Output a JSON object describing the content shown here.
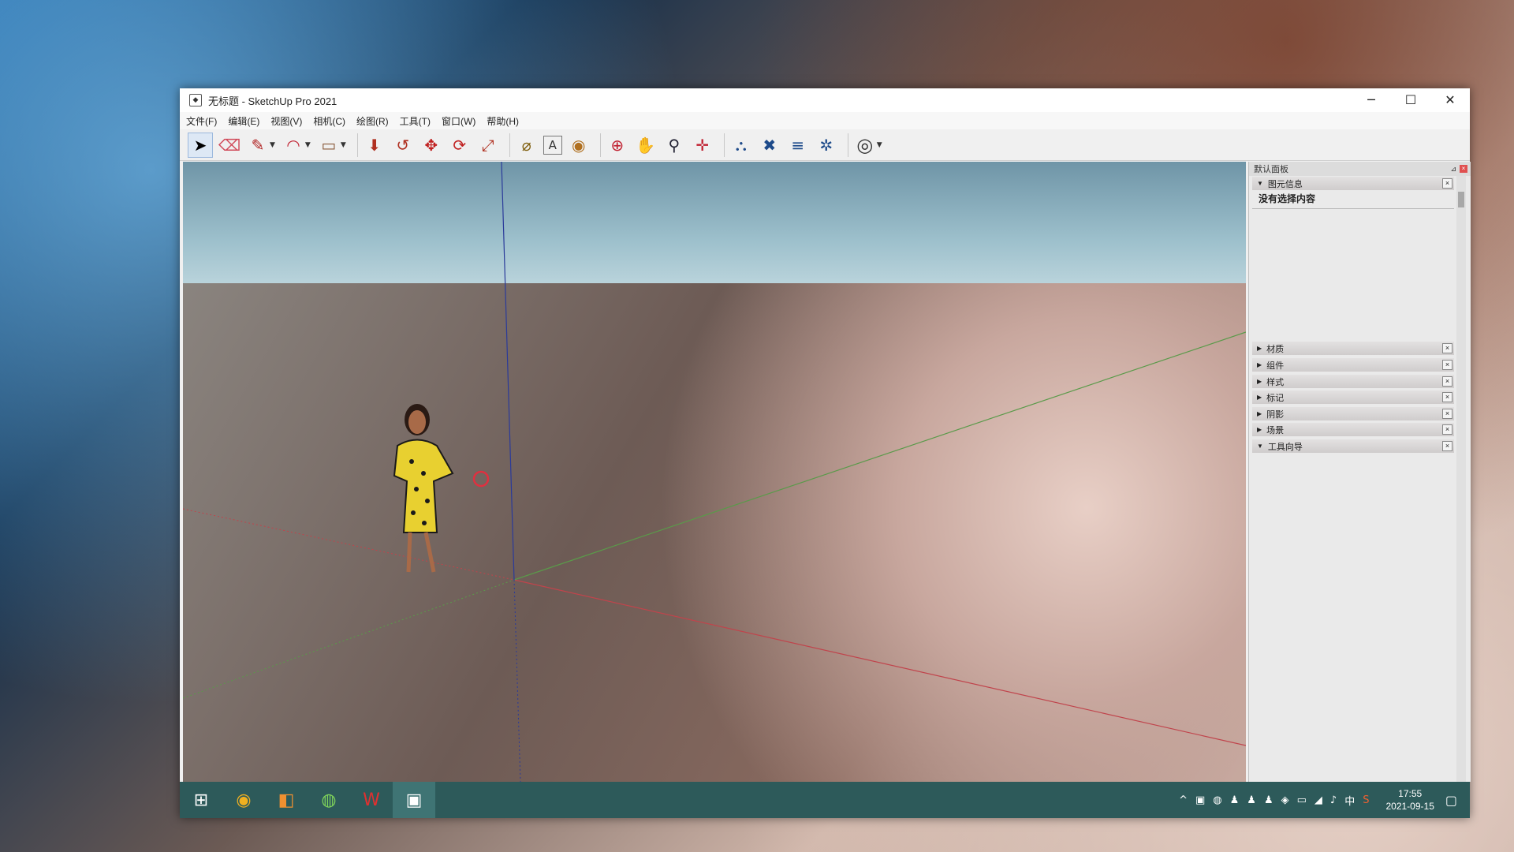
{
  "window": {
    "title": "无标题 - SketchUp Pro 2021",
    "app_icon": "sketchup-icon",
    "controls": {
      "minimize": "─",
      "maximize": "☐",
      "close": "✕"
    }
  },
  "menu": [
    "文件(F)",
    "编辑(E)",
    "视图(V)",
    "相机(C)",
    "绘图(R)",
    "工具(T)",
    "窗口(W)",
    "帮助(H)"
  ],
  "toolbar": {
    "tools": [
      {
        "name": "select-icon",
        "glyph": "➤"
      },
      {
        "name": "eraser-icon",
        "glyph": "⌫"
      },
      {
        "name": "line-icon",
        "glyph": "✎"
      },
      {
        "name": "arc-icon",
        "glyph": "◠"
      },
      {
        "name": "rectangle-icon",
        "glyph": "▭"
      },
      {
        "name": "push-pull-icon",
        "glyph": "⬇"
      },
      {
        "name": "offset-icon",
        "glyph": "↺"
      },
      {
        "name": "move-icon",
        "glyph": "✥"
      },
      {
        "name": "rotate-icon",
        "glyph": "⟳"
      },
      {
        "name": "scale-icon",
        "glyph": "⤢"
      },
      {
        "name": "tape-measure-icon",
        "glyph": "⌀"
      },
      {
        "name": "text-icon",
        "glyph": "A"
      },
      {
        "name": "paint-bucket-icon",
        "glyph": "◉"
      },
      {
        "name": "orbit-icon",
        "glyph": "⊕"
      },
      {
        "name": "pan-icon",
        "glyph": "✋"
      },
      {
        "name": "zoom-icon",
        "glyph": "⚲"
      },
      {
        "name": "zoom-extents-icon",
        "glyph": "✛"
      },
      {
        "name": "warehouse-icon",
        "glyph": "⛬"
      },
      {
        "name": "extension-warehouse-icon",
        "glyph": "✖"
      },
      {
        "name": "layout-icon",
        "glyph": "≡"
      },
      {
        "name": "extension-manager-icon",
        "glyph": "✲"
      },
      {
        "name": "account-icon",
        "glyph": "◎"
      }
    ]
  },
  "panel": {
    "title": "默认面板",
    "entity_info": {
      "label": "图元信息",
      "content": "没有选择内容"
    },
    "trays": [
      {
        "label": "材质",
        "arrow": "▶"
      },
      {
        "label": "组件",
        "arrow": "▶"
      },
      {
        "label": "样式",
        "arrow": "▶"
      },
      {
        "label": "标记",
        "arrow": "▶"
      },
      {
        "label": "阴影",
        "arrow": "▶"
      },
      {
        "label": "场景",
        "arrow": "▶"
      },
      {
        "label": "工具向导",
        "arrow": "▼"
      }
    ]
  },
  "taskbar": {
    "apps": [
      "windows-start-icon",
      "chrome-icon",
      "file-manager-icon",
      "wechat-icon",
      "wps-icon",
      "sketchup-taskbar-icon"
    ],
    "ime": "中",
    "time": "17:55",
    "date": "2021-09-15"
  },
  "colors": {
    "accent": "#2d5a5a",
    "axis_red": "#c0444c",
    "axis_green": "#5a9a4a",
    "axis_blue": "#2a3a9a"
  }
}
